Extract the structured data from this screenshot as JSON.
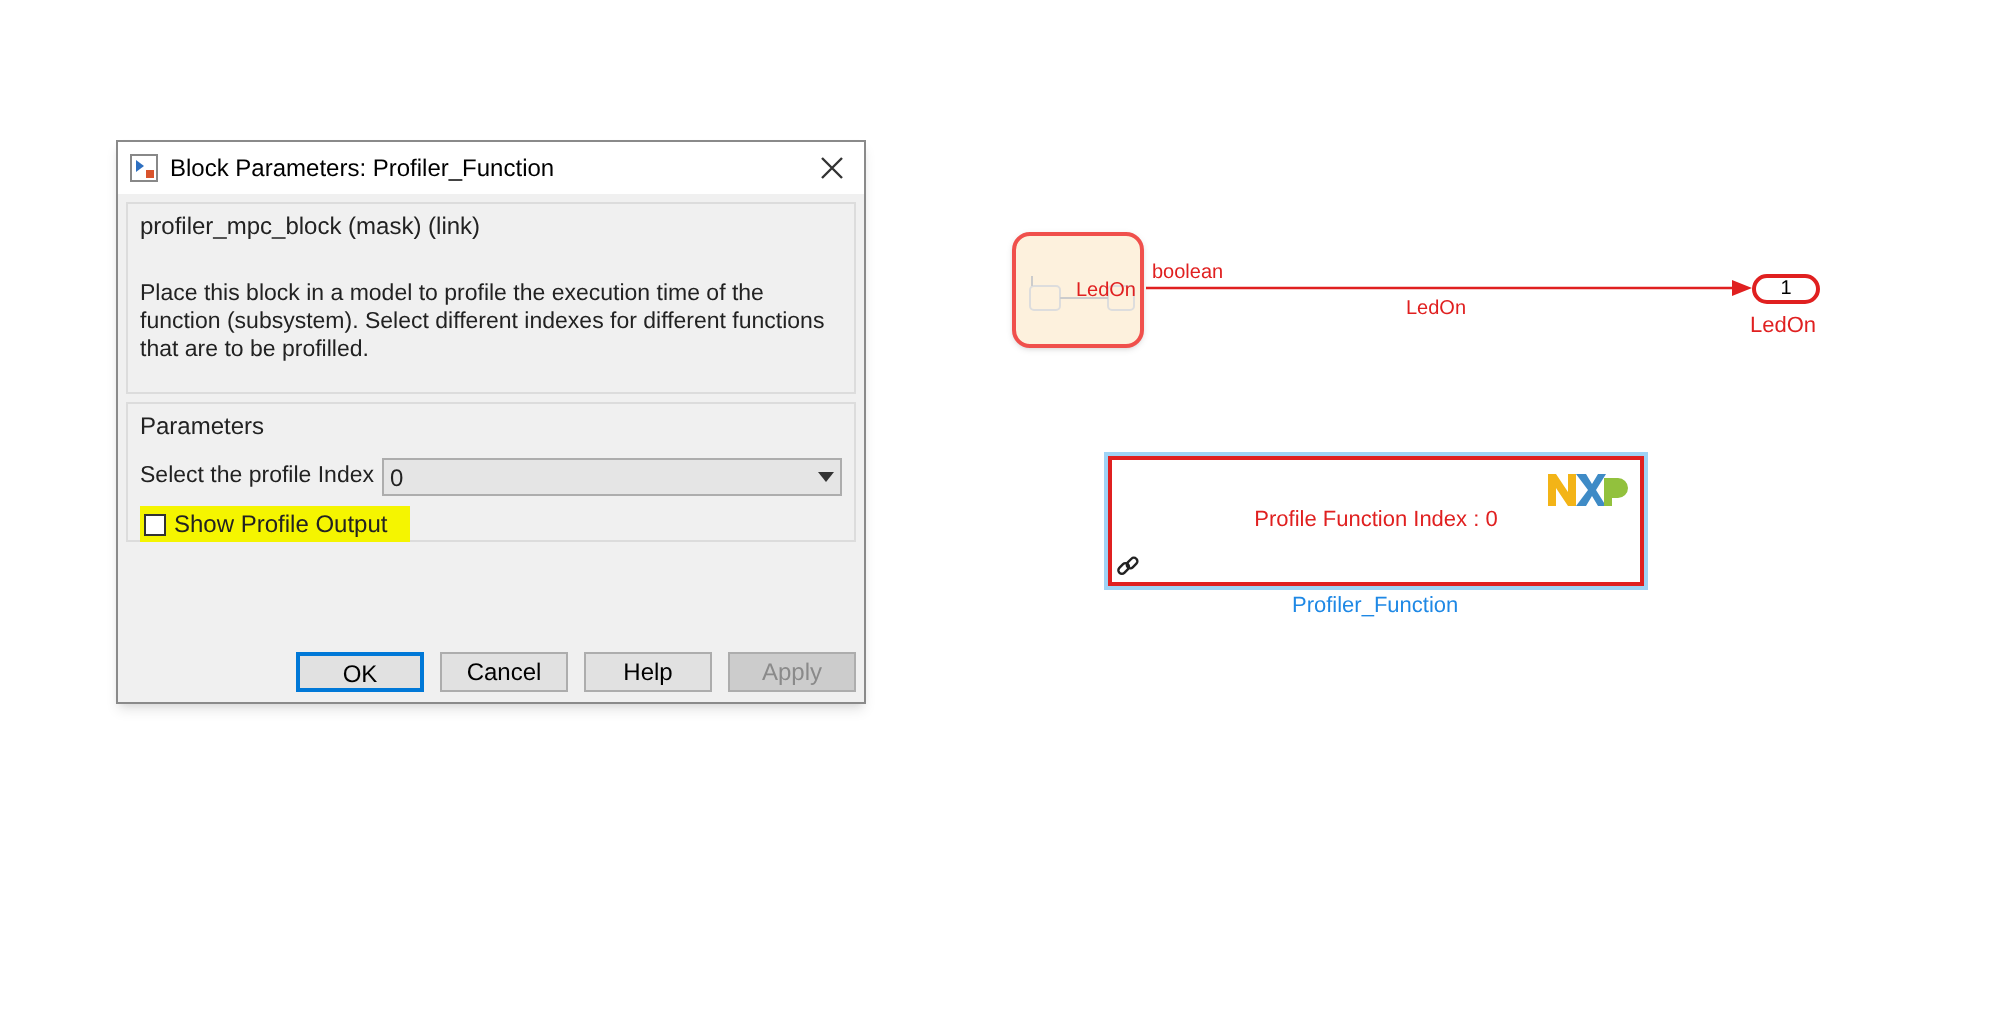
{
  "dialog": {
    "title": "Block Parameters: Profiler_Function",
    "mask_title": "profiler_mpc_block (mask) (link)",
    "description": "Place this block in a model to profile the execution time of the function (subsystem). Select different indexes for different functions that are to be profilled.",
    "parameters_title": "Parameters",
    "index_label": "Select the profile Index",
    "index_value": "0",
    "show_output": {
      "label": "Show Profile Output",
      "checked": false,
      "highlighted": true
    },
    "buttons": [
      {
        "label": "OK",
        "default": true,
        "disabled": false
      },
      {
        "label": "Cancel",
        "default": false,
        "disabled": false
      },
      {
        "label": "Help",
        "default": false,
        "disabled": false
      },
      {
        "label": "Apply",
        "default": false,
        "disabled": true
      }
    ]
  },
  "diagram": {
    "chart_block": {
      "label": "LedOn"
    },
    "signal": {
      "type": "boolean",
      "name": "LedOn"
    },
    "outport": {
      "number": "1",
      "label": "LedOn"
    },
    "subsystem": {
      "text": "Profile Function Index : 0",
      "name": "Profiler_Function",
      "selected": true
    }
  }
}
